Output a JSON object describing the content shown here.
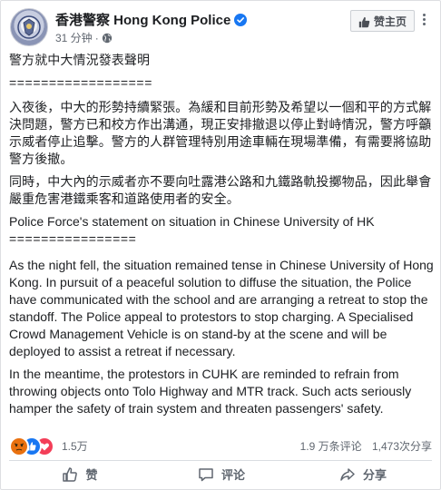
{
  "page": {
    "name": "香港警察 Hong Kong Police",
    "like_button_label": "赞主页"
  },
  "post_meta": {
    "time": "31 分钟",
    "separator": "·"
  },
  "post_body": {
    "zh_title": "警方就中大情況發表聲明",
    "zh_rule": "==================",
    "zh_p1": "入夜後，中大的形勢持續緊張。為緩和目前形勢及希望以一個和平的方式解決問題，警方已和校方作出溝通，現正安排撤退以停止對峙情況，警方呼籲示威者停止追擊。警方的人群管理特別用途車輛在現場準備，有需要將協助警方後撤。",
    "zh_p2": "同時，中大內的示威者亦不要向吐露港公路和九鐵路軌投擲物品，因此舉會嚴重危害港鐵乘客和道路使用者的安全。",
    "en_title": "Police Force's statement on situation in Chinese University of HK",
    "en_rule": "================",
    "en_p1": "As the night fell, the situation remained tense in Chinese University of Hong Kong. In pursuit of a peaceful solution to diffuse the situation, the Police have communicated with the school and are arranging a retreat to stop the standoff. The Police appeal to protestors to stop charging. A Specialised Crowd Management Vehicle is on stand-by at the scene and will be deployed to assist a retreat if necessary.",
    "en_p2": "In the meantime, the protestors in CUHK are reminded to refrain from throwing objects onto Tolo Highway and MTR track. Such acts seriously hamper the safety of train system and threaten passengers' safety."
  },
  "reactions": {
    "count": "1.5万",
    "comments": "1.9 万条评论",
    "shares": "1,473次分享",
    "icons": [
      "angry-icon",
      "like-icon",
      "love-icon"
    ],
    "colors": {
      "angry": "#e9710f",
      "like": "#1877f2",
      "love": "#f33e58"
    }
  },
  "actions": {
    "like": "赞",
    "comment": "评论",
    "share": "分享"
  },
  "colors": {
    "brand_blue": "#1877f2",
    "secondary_text": "#606770",
    "primary_text": "#1c1e21"
  }
}
